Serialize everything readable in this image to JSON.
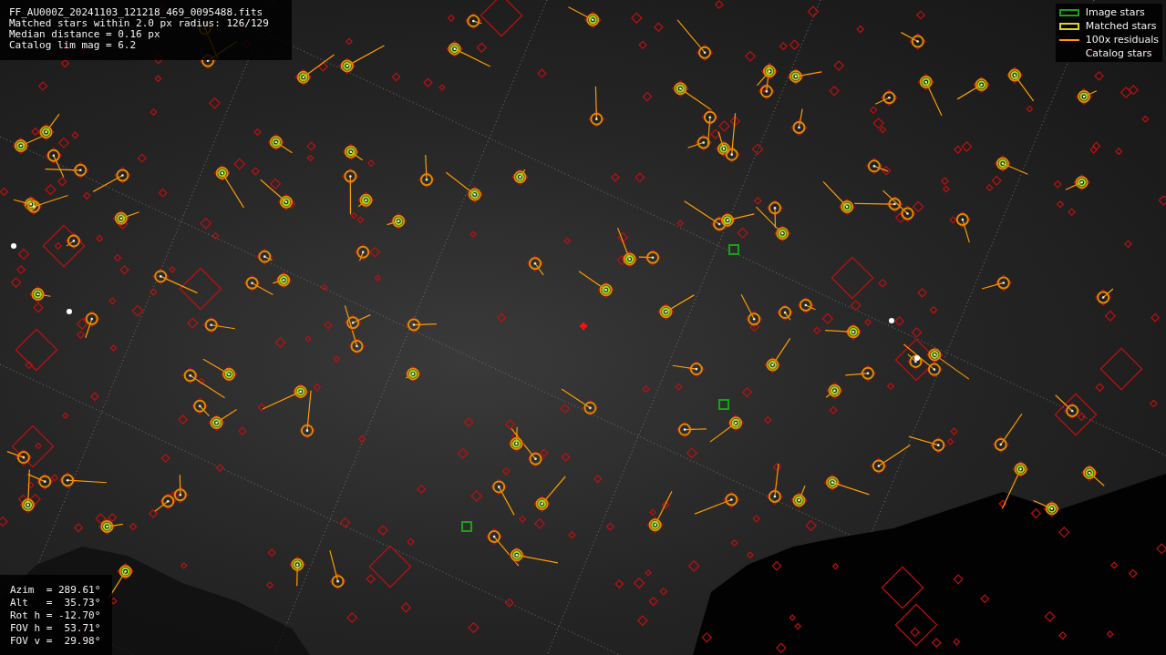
{
  "file_info": {
    "lines": [
      "FF_AU000Z_20241103_121218_469_0095488.fits",
      "Matched stars within 2.0 px radius: 126/129",
      "Median distance = 0.16 px",
      "Catalog lim mag = 6.2"
    ]
  },
  "legend": {
    "items": [
      {
        "kind": "image",
        "label": "Image stars"
      },
      {
        "kind": "matched",
        "label": "Matched stars"
      },
      {
        "kind": "residual",
        "label": "100x residuals"
      },
      {
        "kind": "catalog",
        "label": "Catalog stars"
      }
    ]
  },
  "pointing": {
    "lines": [
      "Azim  = 289.61°",
      "Alt   =  35.73°",
      "Rot h = -12.70°",
      "FOV h =  53.71°",
      "FOV v =  29.98°"
    ]
  }
}
